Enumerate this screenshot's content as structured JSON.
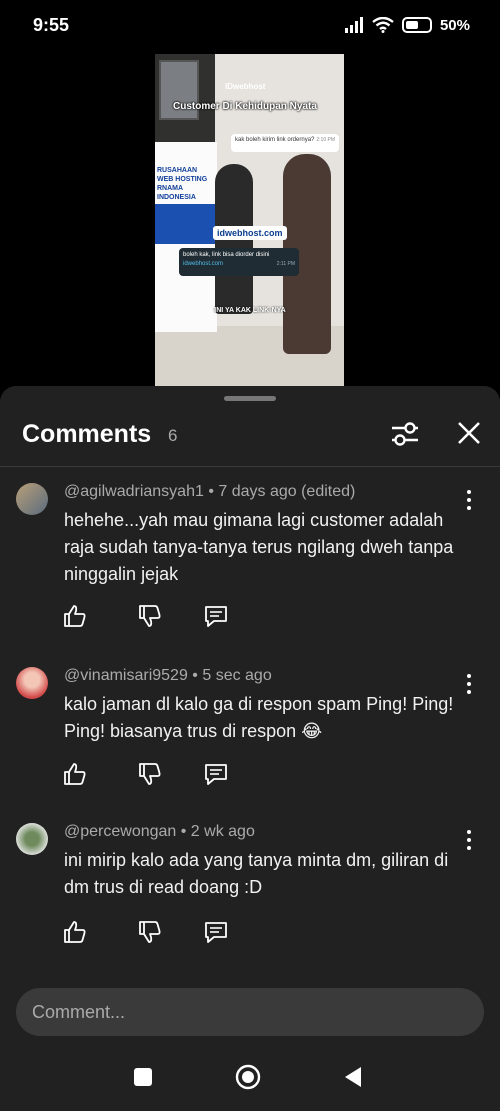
{
  "status_bar": {
    "time": "9:55",
    "battery": "50%"
  },
  "video": {
    "brand": "IDwebhost",
    "caption": "Customer Di Kehidupan Nyata",
    "chat_question": "kak boleh kirim link ordernya?",
    "chat_question_time": "2:10 PM",
    "banner_text": "RUSAHAAN WEB HOSTING RNAMA INDONESIA",
    "domain_pill": "idwebhost.com",
    "chat_answer": "boleh kak, link bisa diorder disini",
    "chat_answer_link": "idwebhost.com",
    "chat_answer_time": "2:11 PM",
    "bottom_caption": "INI YA KAK LINK-NYA"
  },
  "comments_panel": {
    "title": "Comments",
    "count": "6",
    "comments": [
      {
        "author": "@agilwadriansyah1",
        "meta": "@agilwadriansyah1 • 7 days ago (edited)",
        "text": "hehehe...yah mau gimana lagi customer adalah raja sudah tanya-tanya terus ngilang dweh tanpa ninggalin jejak"
      },
      {
        "author": "@vinamisari9529",
        "meta": "@vinamisari9529 • 5 sec ago",
        "text": "kalo jaman dl kalo ga di respon spam Ping! Ping! Ping! biasanya trus di respon 😂"
      },
      {
        "author": "@percewongan",
        "meta": "@percewongan • 2 wk ago",
        "text": "ini mirip kalo ada yang tanya minta dm, giliran di dm trus di read doang :D"
      }
    ],
    "input_placeholder": "Comment..."
  },
  "icons": {
    "filter": "sliders-icon",
    "close": "close-icon",
    "like": "thumbs-up-icon",
    "dislike": "thumbs-down-icon",
    "reply": "reply-icon",
    "more": "more-vert-icon"
  }
}
